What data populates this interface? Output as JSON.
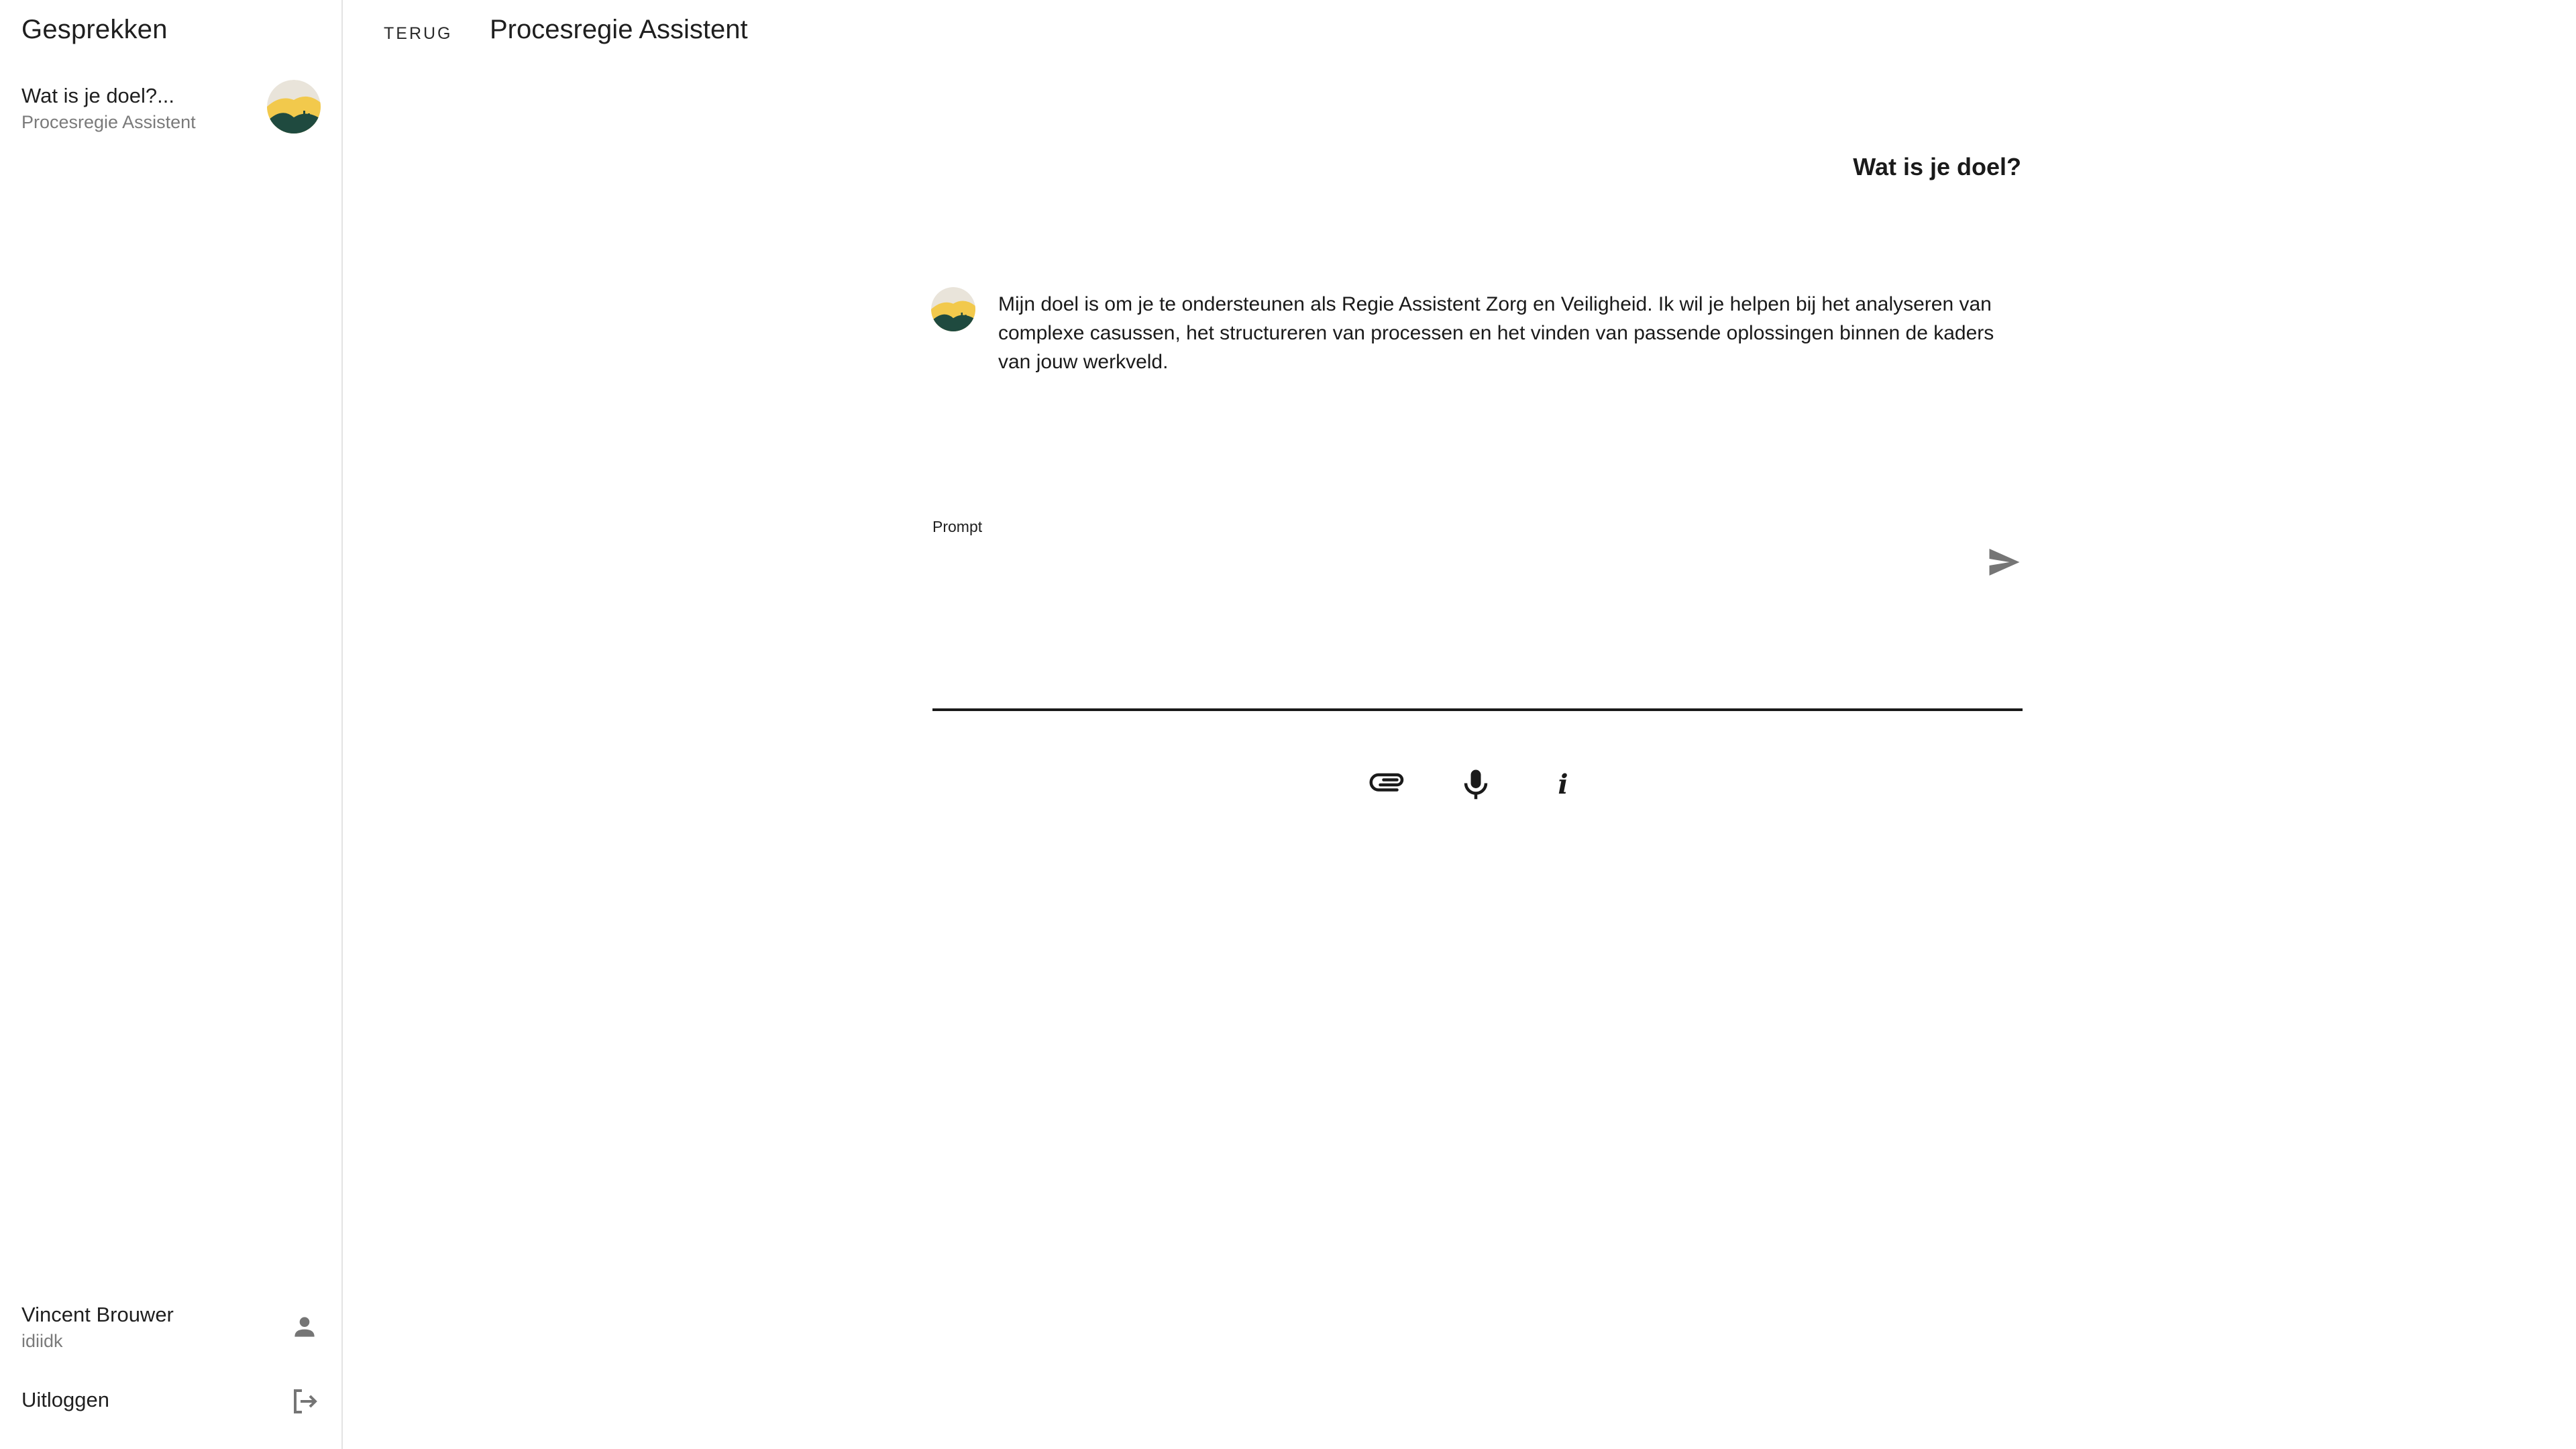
{
  "sidebar": {
    "title": "Gesprekken",
    "conversations": [
      {
        "title": "Wat is je doel?...",
        "subtitle": "Procesregie Assistent",
        "avatar_icon": "assistant-avatar-icon"
      }
    ],
    "user": {
      "name": "Vincent Brouwer",
      "handle": "idiidk",
      "icon": "person-icon"
    },
    "logout": {
      "label": "Uitloggen",
      "icon": "logout-icon"
    }
  },
  "header": {
    "back_label": "TERUG",
    "title": "Procesregie Assistent"
  },
  "chat": {
    "messages": [
      {
        "role": "user",
        "text": "Wat is je doel?"
      },
      {
        "role": "assistant",
        "text": "Mijn doel is om je te ondersteunen als Regie Assistent Zorg en Veiligheid. Ik wil je helpen bij het analyseren van complexe casussen, het structureren van processen en het vinden van passende oplossingen binnen de kaders van jouw werkveld."
      }
    ]
  },
  "prompt": {
    "label": "Prompt",
    "value": "",
    "send_icon": "send-icon"
  },
  "tools": [
    {
      "name": "attach",
      "icon": "paperclip-icon"
    },
    {
      "name": "microphone",
      "icon": "microphone-icon"
    },
    {
      "name": "info",
      "icon": "info-icon"
    }
  ],
  "colors": {
    "text": "#1a1a1a",
    "muted": "#7a7a7a",
    "divider": "#e3e3e3",
    "icon": "#757575",
    "avatar_sky": "#f2c94c",
    "avatar_hill": "#1f4a3f"
  }
}
